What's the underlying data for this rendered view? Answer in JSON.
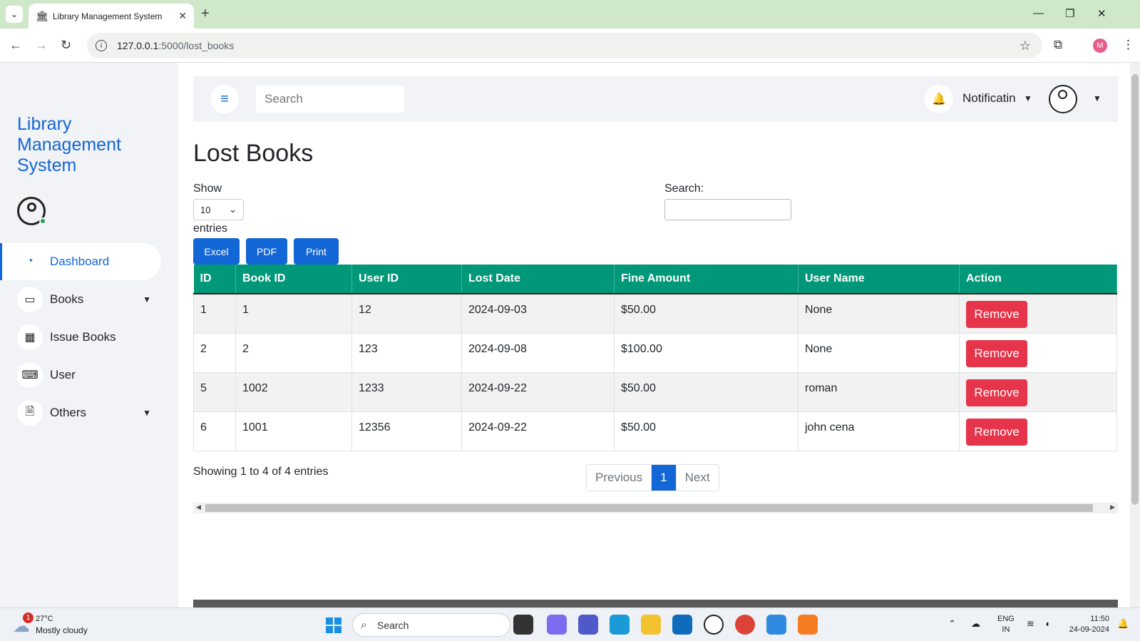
{
  "browser": {
    "tab_title": "Library Management System",
    "url_host": "127.0.0.1",
    "url_rest": ":5000/lost_books",
    "profile_initial": "M"
  },
  "sidebar": {
    "brand": "Library Management System",
    "items": [
      {
        "label": "Dashboard",
        "icon": "gauge-icon"
      },
      {
        "label": "Books",
        "icon": "laptop-icon"
      },
      {
        "label": "Issue Books",
        "icon": "grid-icon"
      },
      {
        "label": "User",
        "icon": "keyboard-icon"
      },
      {
        "label": "Others",
        "icon": "document-icon"
      }
    ]
  },
  "topbar": {
    "search_placeholder": "Search",
    "notification_label": "Notificatin"
  },
  "page": {
    "title": "Lost Books",
    "show_label": "Show",
    "page_length": "10",
    "entries_label": "entries",
    "search_label": "Search:",
    "buttons": {
      "excel": "Excel",
      "pdf": "PDF",
      "print": "Print"
    }
  },
  "table": {
    "headers": [
      "ID",
      "Book ID",
      "User ID",
      "Lost Date",
      "Fine Amount",
      "User Name",
      "Action"
    ],
    "rows": [
      {
        "id": "1",
        "book_id": "1",
        "user_id": "12",
        "lost_date": "2024-09-03",
        "fine": "$50.00",
        "user_name": "None",
        "action": "Remove"
      },
      {
        "id": "2",
        "book_id": "2",
        "user_id": "123",
        "lost_date": "2024-09-08",
        "fine": "$100.00",
        "user_name": "None",
        "action": "Remove"
      },
      {
        "id": "5",
        "book_id": "1002",
        "user_id": "1233",
        "lost_date": "2024-09-22",
        "fine": "$50.00",
        "user_name": "roman",
        "action": "Remove"
      },
      {
        "id": "6",
        "book_id": "1001",
        "user_id": "12356",
        "lost_date": "2024-09-22",
        "fine": "$50.00",
        "user_name": "john cena",
        "action": "Remove"
      }
    ]
  },
  "pagination": {
    "info": "Showing 1 to 4 of 4 entries",
    "previous": "Previous",
    "current": "1",
    "next": "Next"
  },
  "taskbar": {
    "weather_temp": "27°C",
    "weather_desc": "Mostly cloudy",
    "weather_badge": "1",
    "search": "Search",
    "lang_line1": "ENG",
    "lang_line2": "IN",
    "time": "11:50",
    "date": "24-09-2024"
  },
  "colors": {
    "accent": "#1366d6",
    "table_header": "#009879",
    "remove": "#e6344a"
  }
}
